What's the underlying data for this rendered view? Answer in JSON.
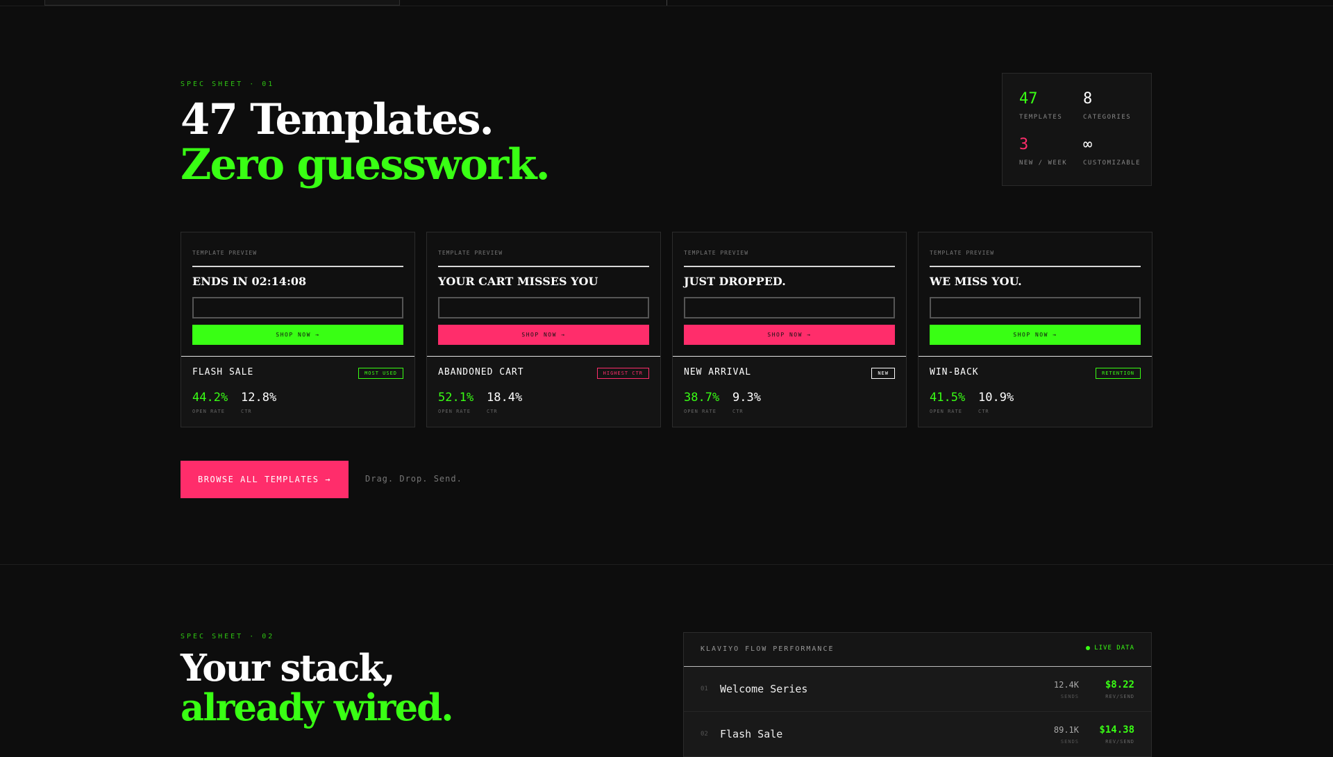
{
  "spec1": {
    "eyebrow": "SPEC SHEET · 01",
    "headline_white": "47 Templates.",
    "headline_green": "Zero guesswork.",
    "stats": [
      {
        "value": "47",
        "label": "TEMPLATES",
        "color": "#39ff14"
      },
      {
        "value": "8",
        "label": "CATEGORIES",
        "color": "#ffffff"
      },
      {
        "value": "3",
        "label": "NEW / WEEK",
        "color": "#ff2d6b"
      },
      {
        "value": "∞",
        "label": "CUSTOMIZABLE",
        "color": "#ffffff"
      }
    ],
    "cards": [
      {
        "preview_label": "TEMPLATE PREVIEW",
        "preview_headline": "ENDS IN 02:14:08",
        "button": "SHOP NOW →",
        "button_color": "#39ff14",
        "name": "FLASH SALE",
        "tag": "MOST USED",
        "tag_color": "#39ff14",
        "open_rate": "44.2%",
        "ctr": "12.8%",
        "open_label": "OPEN RATE",
        "ctr_label": "CTR"
      },
      {
        "preview_label": "TEMPLATE PREVIEW",
        "preview_headline": "YOUR CART MISSES YOU",
        "button": "SHOP NOW →",
        "button_color": "#ff2d6b",
        "name": "ABANDONED CART",
        "tag": "HIGHEST CTR",
        "tag_color": "#ff2d6b",
        "open_rate": "52.1%",
        "ctr": "18.4%",
        "open_label": "OPEN RATE",
        "ctr_label": "CTR"
      },
      {
        "preview_label": "TEMPLATE PREVIEW",
        "preview_headline": "JUST DROPPED.",
        "button": "SHOP NOW →",
        "button_color": "#ff2d6b",
        "name": "NEW ARRIVAL",
        "tag": "NEW",
        "tag_color": "#ffffff",
        "open_rate": "38.7%",
        "ctr": "9.3%",
        "open_label": "OPEN RATE",
        "ctr_label": "CTR"
      },
      {
        "preview_label": "TEMPLATE PREVIEW",
        "preview_headline": "WE MISS YOU.",
        "button": "SHOP NOW →",
        "button_color": "#39ff14",
        "name": "WIN-BACK",
        "tag": "RETENTION",
        "tag_color": "#39ff14",
        "open_rate": "41.5%",
        "ctr": "10.9%",
        "open_label": "OPEN RATE",
        "ctr_label": "CTR"
      }
    ],
    "browse_button": "BROWSE ALL TEMPLATES →",
    "tagline": "Drag. Drop. Send."
  },
  "spec2": {
    "eyebrow": "SPEC SHEET · 02",
    "headline_white": "Your stack,",
    "headline_green": "already wired.",
    "panel": {
      "title": "KLAVIYO FLOW PERFORMANCE",
      "live_label": "LIVE DATA",
      "rows": [
        {
          "index": "01",
          "name": "Welcome Series",
          "sends": "12.4K",
          "sends_label": "SENDS",
          "rev": "$8.22",
          "rev_label": "REV/SEND"
        },
        {
          "index": "02",
          "name": "Flash Sale",
          "sends": "89.1K",
          "sends_label": "SENDS",
          "rev": "$14.38",
          "rev_label": "REV/SEND"
        }
      ]
    }
  },
  "colors": {
    "accent_green": "#39ff14",
    "accent_pink": "#ff2d6b",
    "background": "#0d0d0d"
  }
}
